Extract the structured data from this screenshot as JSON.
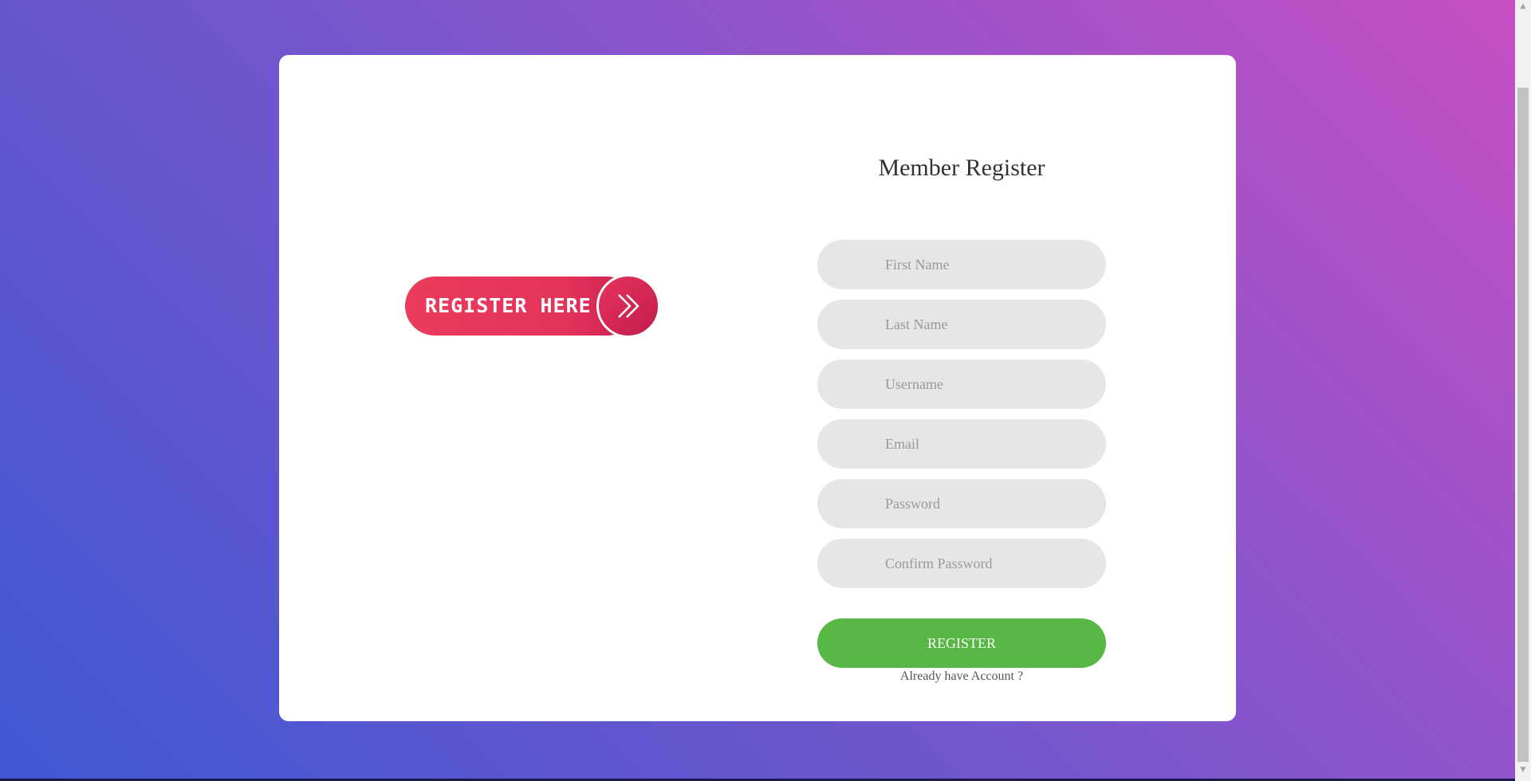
{
  "promo": {
    "label": "REGISTER HERE",
    "icon": "double-chevron-right-icon"
  },
  "form": {
    "title": "Member Register",
    "fields": [
      {
        "placeholder": "First Name",
        "value": ""
      },
      {
        "placeholder": "Last Name",
        "value": ""
      },
      {
        "placeholder": "Username",
        "value": ""
      },
      {
        "placeholder": "Email",
        "value": ""
      },
      {
        "placeholder": "Password",
        "value": ""
      },
      {
        "placeholder": "Confirm Password",
        "value": ""
      }
    ],
    "submit_label": "REGISTER",
    "login_link": "Already have Account ?"
  },
  "colors": {
    "accent_green": "#57b846",
    "promo_red": "#e4335a",
    "gradient_start": "#3f58d3",
    "gradient_end": "#c84fc4"
  }
}
